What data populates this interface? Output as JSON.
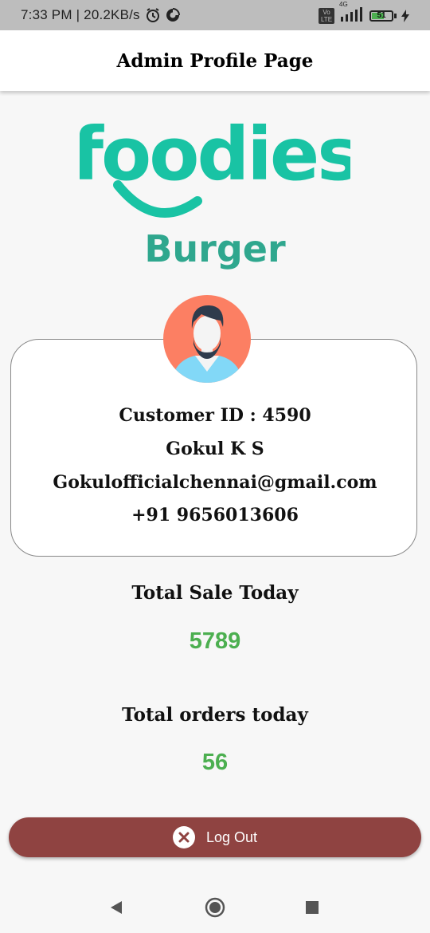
{
  "status_bar": {
    "time_network": "7:33 PM | 20.2KB/s",
    "network_type": "4G",
    "volte": "Vo LTE",
    "battery_level": "51"
  },
  "appbar": {
    "title": "Admin Profile Page"
  },
  "logo": {
    "brand": "foodies",
    "subtitle": "Burger",
    "brand_color": "#19c3a4",
    "subtitle_color": "#2fa78e"
  },
  "profile": {
    "customer_id": "Customer ID : 4590",
    "name": "Gokul K S",
    "email": "Gokulofficialchennai@gmail.com",
    "phone": "+91 9656013606"
  },
  "stats": {
    "sale_label": "Total Sale Today",
    "sale_value": "5789",
    "orders_label": "Total orders today",
    "orders_value": "56",
    "value_color": "#4caf50"
  },
  "logout": {
    "label": "Log Out",
    "icon": "close-circle-icon",
    "color": "#8f4341"
  },
  "navbar": {
    "icons": [
      "back-icon",
      "home-icon",
      "recents-icon"
    ]
  }
}
